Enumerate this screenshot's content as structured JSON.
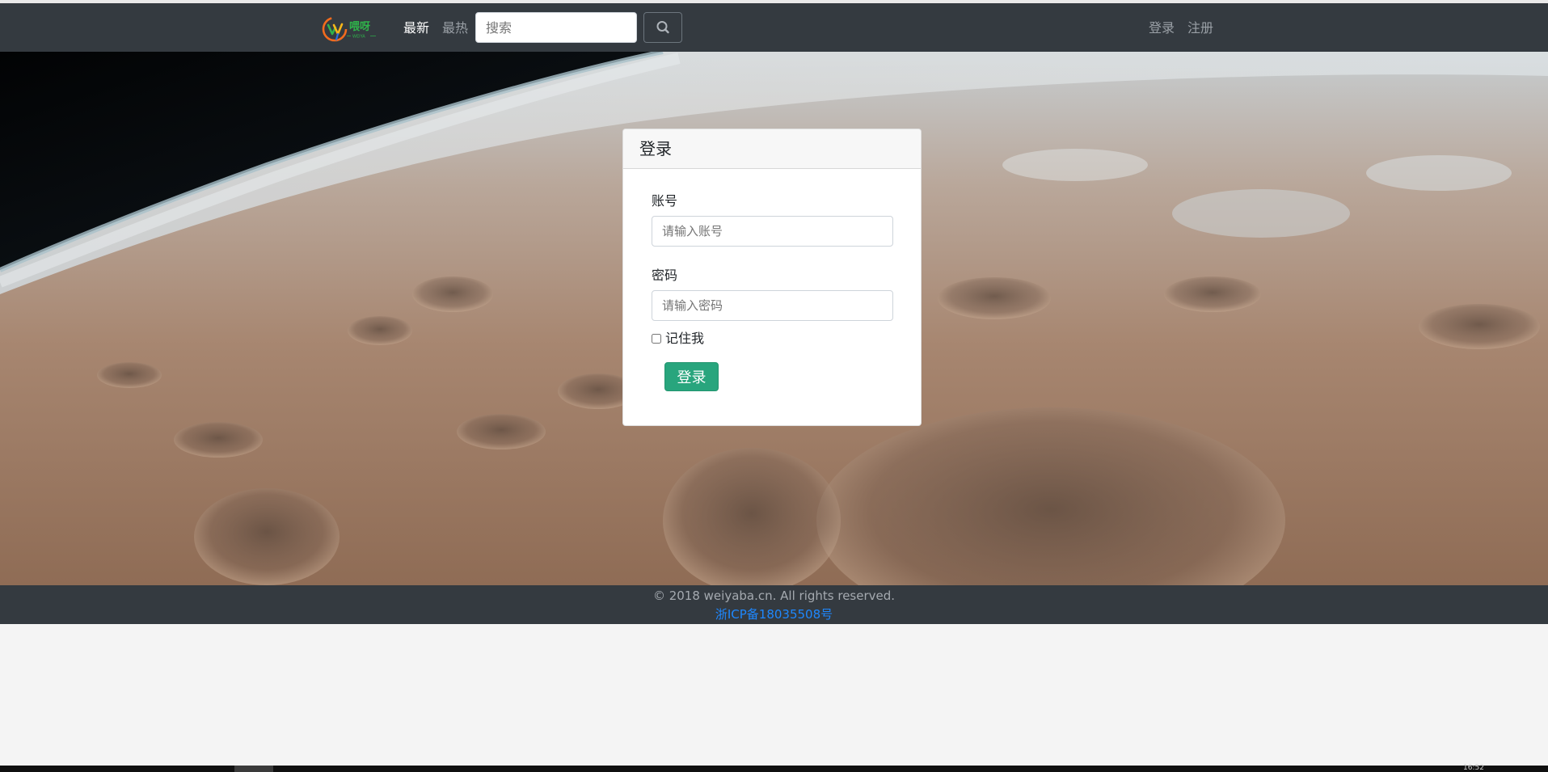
{
  "brand": {
    "logo_text": "喂呀",
    "logo_subtext": "WEIYA",
    "colors": {
      "green": "#2fb34a",
      "orange": "#f26b1d",
      "yellow": "#f6b619",
      "blue": "#2f6fdc"
    }
  },
  "navbar": {
    "links": [
      {
        "label": "最新",
        "active": true
      },
      {
        "label": "最热",
        "active": false
      }
    ],
    "search": {
      "placeholder": "搜索",
      "value": "",
      "button_icon": "search-icon"
    },
    "auth": {
      "login": "登录",
      "register": "注册"
    }
  },
  "login_card": {
    "title": "登录",
    "account": {
      "label": "账号",
      "placeholder": "请输入账号",
      "value": ""
    },
    "password": {
      "label": "密码",
      "placeholder": "请输入密码",
      "value": ""
    },
    "remember": {
      "label": "记住我",
      "checked": false
    },
    "submit": "登录"
  },
  "footer": {
    "copyright": "© 2018 weiyaba.cn. All rights reserved.",
    "icp": "浙ICP备18035508号"
  },
  "taskbar": {
    "clock": "16:52"
  },
  "colors": {
    "navbar_bg": "#343a40",
    "primary_button": "#28a57d",
    "link_blue": "#1e88ff"
  }
}
